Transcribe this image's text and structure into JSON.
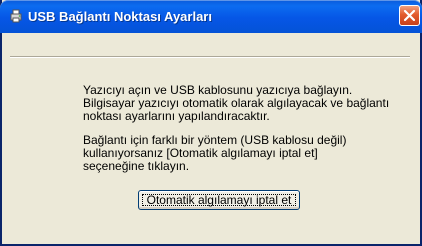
{
  "window": {
    "title": "USB Bağlantı Noktası Ayarları",
    "icon": "printer-setup-icon",
    "close_icon": "close-icon"
  },
  "body": {
    "paragraph1_lines": [
      "Yazıcıyı açın ve USB kablosunu yazıcıya bağlayın.",
      "Bilgisayar yazıcıyı otomatik olarak algılayacak ve bağlantı",
      "noktası ayarlarını yapılandıracaktır."
    ],
    "paragraph2_lines": [
      "Bağlantı için farklı bir yöntem (USB kablosu değil)",
      "kullanıyorsanız [Otomatik algılamayı iptal et]",
      "seçeneğine tıklayın."
    ]
  },
  "actions": {
    "cancel_auto_detect_label": "Otomatik algılamayı iptal et"
  },
  "colors": {
    "titlebar": "#0656e6",
    "window_bg": "#ece9d8",
    "close_button": "#e35b2d"
  }
}
